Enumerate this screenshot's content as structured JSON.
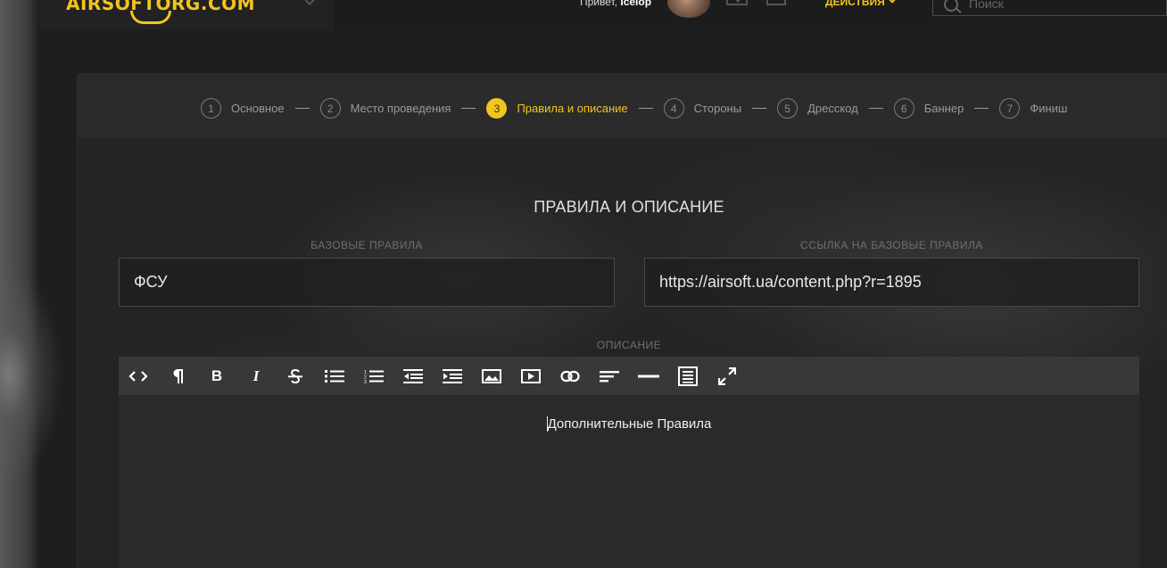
{
  "header": {
    "logo_text": "AIRSOFTORG.COM",
    "greeting_prefix": "Привет,",
    "username": "Icelop",
    "actions_label": "ДЕЙСТВИЯ",
    "search_placeholder": "Поиск"
  },
  "steps": [
    {
      "num": "1",
      "label": "Основное",
      "active": false
    },
    {
      "num": "2",
      "label": "Место проведения",
      "active": false
    },
    {
      "num": "3",
      "label": "Правила и описание",
      "active": true
    },
    {
      "num": "4",
      "label": "Стороны",
      "active": false
    },
    {
      "num": "5",
      "label": "Дресскод",
      "active": false
    },
    {
      "num": "6",
      "label": "Баннер",
      "active": false
    },
    {
      "num": "7",
      "label": "Финиш",
      "active": false
    }
  ],
  "section": {
    "title": "ПРАВИЛА И ОПИСАНИЕ",
    "base_rules_label": "БАЗОВЫЕ ПРАВИЛА",
    "base_rules_value": "ФСУ",
    "rules_link_label": "ССЫЛКА НА БАЗОВЫЕ ПРАВИЛА",
    "rules_link_value": "https://airsoft.ua/content.php?r=1895",
    "description_label": "ОПИСАНИЕ",
    "description_text": "Дополнительные Правила"
  },
  "toolbar": [
    "code-icon",
    "paragraph-icon",
    "bold-icon",
    "italic-icon",
    "strikethrough-icon",
    "unordered-list-icon",
    "ordered-list-icon",
    "outdent-icon",
    "indent-icon",
    "image-icon",
    "video-icon",
    "link-icon",
    "align-left-icon",
    "horizontal-rule-icon",
    "document-icon",
    "fullscreen-icon"
  ],
  "colors": {
    "accent": "#f2c41e",
    "background": "#242424",
    "toolbar": "#383838",
    "editor": "#2a2a2a"
  }
}
